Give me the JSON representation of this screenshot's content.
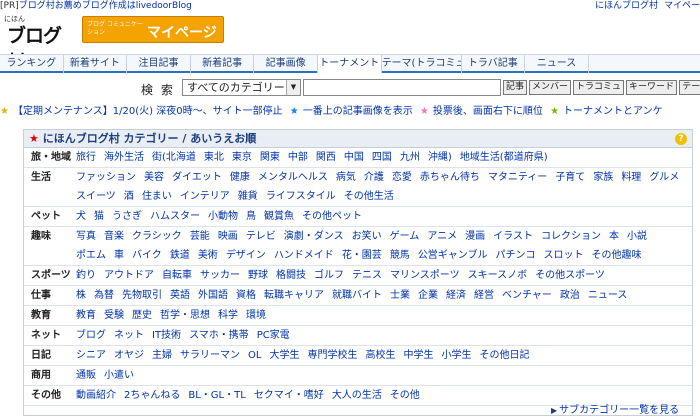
{
  "pr_bar": {
    "tag": "[PR]",
    "text": "ブログ村お薦めブログ作成はlivedoorBlog",
    "right_links": [
      "にほんブログ村",
      "マイペー"
    ]
  },
  "logo": {
    "small": "にほん",
    "big": "ブログ村"
  },
  "mypage_button": {
    "sub": "ブログ コミュニケーション",
    "label": "マイページ"
  },
  "tabs": [
    "ランキング",
    "新着サイト",
    "注目記事",
    "新着記事",
    "記事画像",
    "トーナメント",
    "テーマ(トラコミュ)",
    "トラバ記事",
    "ニュース"
  ],
  "search": {
    "label": "検 索",
    "category_selected": "すべてのカテゴリー",
    "input_value": "",
    "buttons": [
      "記事",
      "メンバー",
      "トラコミュ",
      "キーワード",
      "テーマ"
    ]
  },
  "notice": {
    "items": [
      "【定期メンテナンス】1/20(火) 深夜0時〜、サイト一部停止",
      "一番上の記事画像を表示",
      "投票後、画面右下に順位",
      "トーナメントとアンケ"
    ]
  },
  "category_panel": {
    "title": "にほんブログ村 カテゴリー / あいうえお順",
    "help": "?",
    "rows": [
      {
        "label": "旅・地域",
        "items": [
          "旅行",
          "海外生活",
          "街(北海道",
          "東北",
          "東京",
          "関東",
          "中部",
          "関西",
          "中国",
          "四国",
          "九州",
          "沖縄)",
          "地域生活(都道府県)"
        ]
      },
      {
        "label": "生活",
        "items": [
          "ファッション",
          "美容",
          "ダイエット",
          "健康",
          "メンタルヘルス",
          "病気",
          "介護",
          "恋愛",
          "赤ちゃん待ち",
          "マタニティー",
          "子育て",
          "家族",
          "料理",
          "グルメ",
          "スイーツ",
          "酒",
          "住まい",
          "インテリア",
          "雑貨",
          "ライフスタイル",
          "その他生活"
        ]
      },
      {
        "label": "ペット",
        "items": [
          "犬",
          "猫",
          "うさぎ",
          "ハムスター",
          "小動物",
          "鳥",
          "観賞魚",
          "その他ペット"
        ]
      },
      {
        "label": "趣味",
        "items": [
          "写真",
          "音楽",
          "クラシック",
          "芸能",
          "映画",
          "テレビ",
          "演劇・ダンス",
          "お笑い",
          "ゲーム",
          "アニメ",
          "漫画",
          "イラスト",
          "コレクション",
          "本",
          "小説",
          "ポエム",
          "車",
          "バイク",
          "鉄道",
          "美術",
          "デザイン",
          "ハンドメイド",
          "花・園芸",
          "競馬",
          "公営ギャンブル",
          "パチンコ",
          "スロット",
          "その他趣味"
        ]
      },
      {
        "label": "スポーツ",
        "items": [
          "釣り",
          "アウトドア",
          "自転車",
          "サッカー",
          "野球",
          "格闘技",
          "ゴルフ",
          "テニス",
          "マリンスポーツ",
          "スキースノボ",
          "その他スポーツ"
        ]
      },
      {
        "label": "仕事",
        "items": [
          "株",
          "為替",
          "先物取引",
          "英語",
          "外国語",
          "資格",
          "転職キャリア",
          "就職バイト",
          "士業",
          "企業",
          "経済",
          "経営",
          "ベンチャー",
          "政治",
          "ニュース"
        ]
      },
      {
        "label": "教育",
        "items": [
          "教育",
          "受験",
          "歴史",
          "哲学・思想",
          "科学",
          "環境"
        ]
      },
      {
        "label": "ネット",
        "items": [
          "ブログ",
          "ネット",
          "IT技術",
          "スマホ・携帯",
          "PC家電"
        ]
      },
      {
        "label": "日記",
        "items": [
          "シニア",
          "オヤジ",
          "主婦",
          "サラリーマン",
          "OL",
          "大学生",
          "専門学校生",
          "高校生",
          "中学生",
          "小学生",
          "その他日記"
        ]
      },
      {
        "label": "商用",
        "items": [
          "通販",
          "小遣い"
        ]
      },
      {
        "label": "その他",
        "items": [
          "動画紹介",
          "2ちゃんねる",
          "BL・GL・TL",
          "セクマイ・嗜好",
          "大人の生活",
          "その他"
        ]
      }
    ]
  },
  "more_link": "サブカテゴリー一覧を見る"
}
